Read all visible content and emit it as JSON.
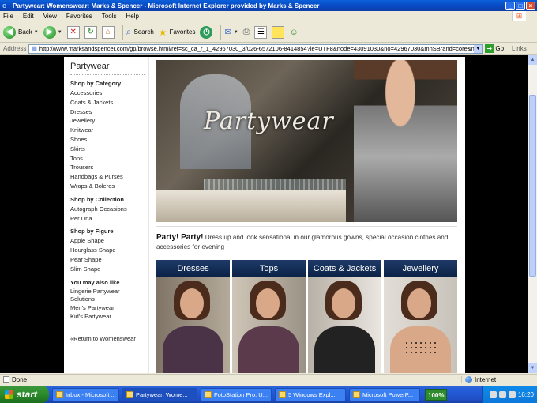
{
  "window": {
    "title": "Partywear: Womenswear: Marks & Spencer - Microsoft Internet Explorer provided by Marks & Spencer"
  },
  "menu": [
    "File",
    "Edit",
    "View",
    "Favorites",
    "Tools",
    "Help"
  ],
  "toolbar": {
    "back": "Back",
    "search": "Search",
    "favorites": "Favorites"
  },
  "address": {
    "label": "Address",
    "url": "http://www.marksandspencer.com/gp/browse.html/ref=sc_ca_r_1_42967030_3/026-6572106-8414854?ie=UTF8&node=43091030&no=42967030&mnSBrand=core&me=A",
    "go": "Go",
    "links": "Links"
  },
  "nav": {
    "title": "Partywear",
    "sections": [
      {
        "heading": "Shop by Category",
        "items": [
          "Accessories",
          "Coats & Jackets",
          "Dresses",
          "Jewellery",
          "Knitwear",
          "Shoes",
          "Skirts",
          "Tops",
          "Trousers",
          "Handbags & Purses",
          "Wraps & Boleros"
        ]
      },
      {
        "heading": "Shop by Collection",
        "items": [
          "Autograph Occasions",
          "Per Una"
        ]
      },
      {
        "heading": "Shop by Figure",
        "items": [
          "Apple Shape",
          "Hourglass Shape",
          "Pear Shape",
          "Slim Shape"
        ]
      },
      {
        "heading": "You may also like",
        "items": [
          "Lingerie Partywear Solutions",
          "Men's Partywear",
          "Kid's Partywear"
        ]
      }
    ],
    "return": "«Return to Womenswear"
  },
  "hero": {
    "text": "Partywear"
  },
  "intro": {
    "bold": "Party! Party!",
    "text": " Dress up and look sensational in our glamorous gowns, special occasion clothes and accessories for evening"
  },
  "tiles": [
    "Dresses",
    "Tops",
    "Coats & Jackets",
    "Jewellery"
  ],
  "status": {
    "left": "Done",
    "zone": "Internet"
  },
  "taskbar": {
    "start": "start",
    "tasks": [
      "Inbox - Microsoft ...",
      "Partywear: Wome...",
      "FotoStation Pro: U...",
      "5 Windows Expl...",
      "Microsoft PowerP..."
    ],
    "battery": "100%",
    "clock": "16:20"
  }
}
